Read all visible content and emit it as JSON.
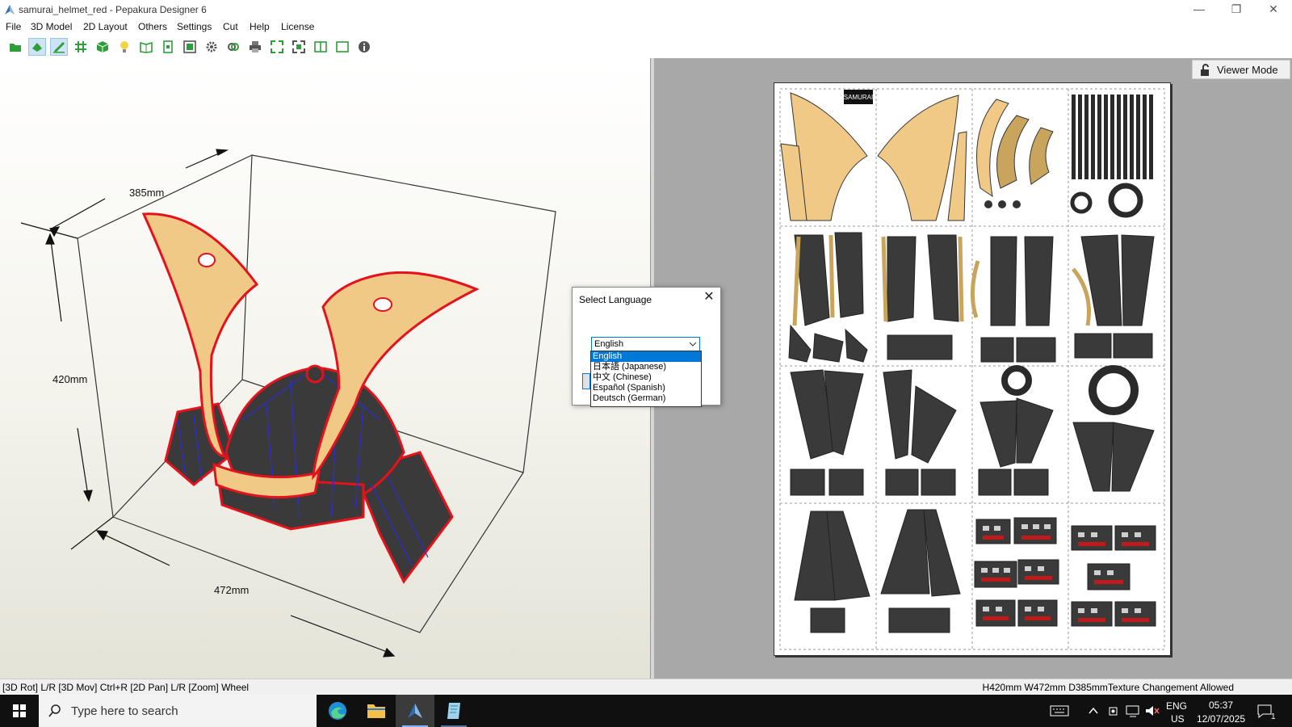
{
  "window": {
    "title": "samurai_helmet_red - Pepakura Designer 6",
    "controls": {
      "minimize": "—",
      "restore": "❐",
      "close": "✕"
    }
  },
  "menu": [
    "File",
    "3D Model",
    "2D Layout",
    "Others",
    "Settings",
    "Cut",
    "Help",
    "License"
  ],
  "toolbar": {
    "icons": [
      "open-folder-icon",
      "unfold-icon",
      "edit-icon",
      "grid-icon",
      "cube-icon",
      "light-bulb-icon",
      "book-icon",
      "page-icon",
      "fit-icon",
      "gear-icon",
      "link-icon",
      "print-icon",
      "expand-icon",
      "expand-all-icon",
      "split-view-icon",
      "single-view-icon",
      "info-icon"
    ]
  },
  "view3d": {
    "dimensions": {
      "depth": "385mm",
      "height": "420mm",
      "width": "472mm"
    }
  },
  "view2d": {
    "viewer_mode_label": "Viewer Mode",
    "sheet_logo": "SAMURAI"
  },
  "dialog": {
    "title": "Select Language",
    "selected": "English",
    "options": [
      "English",
      "日本語 (Japanese)",
      "中文 (Chinese)",
      "Español (Spanish)",
      "Deutsch (German)"
    ]
  },
  "statusbar": {
    "left": "[3D Rot] L/R [3D Mov] Ctrl+R [2D Pan] L/R [Zoom] Wheel",
    "right": "H420mm W472mm D385mmTexture Changement Allowed"
  },
  "taskbar": {
    "search_placeholder": "Type here to search",
    "language": "ENG",
    "region": "US",
    "time": "05:37",
    "date": "12/07/2025",
    "notification_count": "1"
  },
  "colors": {
    "accent": "#0078d7",
    "part_fill": "#f0c987",
    "part_edge": "#e5121b",
    "dark_part": "#3a3a3a",
    "fold_line": "#2b2bd9"
  }
}
